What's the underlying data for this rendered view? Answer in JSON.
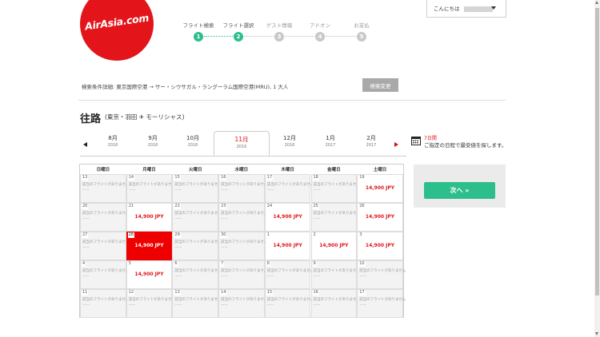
{
  "brand": {
    "logo_text": "AirAsia.com",
    "accent": "#e3151a",
    "success": "#2dbf8b"
  },
  "steps": [
    {
      "label": "フライト検索",
      "number": "1",
      "state": "done"
    },
    {
      "label": "フライト選択",
      "number": "2",
      "state": "done"
    },
    {
      "label": "ゲスト情報",
      "number": "3",
      "state": "todo"
    },
    {
      "label": "アドオン",
      "number": "4",
      "state": "todo"
    },
    {
      "label": "お支払",
      "number": "5",
      "state": "todo"
    }
  ],
  "user": {
    "greeting": "こんにちは"
  },
  "search": {
    "summary": "検索条件詳細: 東京国際空港 → サー・シウサガル・ラングーラム国際空港(MRU), 1 大人",
    "change_label": "検索変更"
  },
  "route": {
    "title": "往路",
    "subtitle": "(東京・羽田 ✈ モーリシャス)"
  },
  "months": [
    {
      "month": "8月",
      "year": "2016"
    },
    {
      "month": "9月",
      "year": "2016"
    },
    {
      "month": "10月",
      "year": "2016"
    },
    {
      "month": "11月",
      "year": "2016",
      "active": true
    },
    {
      "month": "12月",
      "year": "2016"
    },
    {
      "month": "1月",
      "year": "2017"
    },
    {
      "month": "2月",
      "year": "2017"
    }
  ],
  "cheapest": {
    "title": "7日間",
    "desc": "ご指定の日程で最安値を探します。"
  },
  "weekdays": [
    "日曜日",
    "月曜日",
    "火曜日",
    "水曜日",
    "木曜日",
    "金曜日",
    "土曜日"
  ],
  "no_flight_text": "該当のフライトがありません",
  "no_flight_sub": "ーー",
  "calendar": [
    [
      {
        "d": "13"
      },
      {
        "d": "14"
      },
      {
        "d": "15"
      },
      {
        "d": "16"
      },
      {
        "d": "17"
      },
      {
        "d": "18"
      },
      {
        "d": "19",
        "price": "14,900 JPY"
      }
    ],
    [
      {
        "d": "20"
      },
      {
        "d": "21",
        "price": "14,900 JPY"
      },
      {
        "d": "22"
      },
      {
        "d": "23"
      },
      {
        "d": "24",
        "price": "14,900 JPY"
      },
      {
        "d": "25"
      },
      {
        "d": "26",
        "price": "14,900 JPY"
      }
    ],
    [
      {
        "d": "27"
      },
      {
        "d": "28",
        "price": "14,900 JPY",
        "selected": true
      },
      {
        "d": "29"
      },
      {
        "d": "30"
      },
      {
        "d": "1",
        "price": "14,900 JPY"
      },
      {
        "d": "2",
        "price": "14,900 JPY"
      },
      {
        "d": "3",
        "price": "14,900 JPY"
      }
    ],
    [
      {
        "d": "4"
      },
      {
        "d": "5",
        "price": "14,900 JPY"
      },
      {
        "d": "6"
      },
      {
        "d": "7"
      },
      {
        "d": "8"
      },
      {
        "d": "9"
      },
      {
        "d": "10"
      }
    ],
    [
      {
        "d": "11"
      },
      {
        "d": "12"
      },
      {
        "d": "13"
      },
      {
        "d": "14"
      },
      {
        "d": "15"
      },
      {
        "d": "16"
      },
      {
        "d": "17"
      }
    ]
  ],
  "next": {
    "label": "次へ »"
  }
}
